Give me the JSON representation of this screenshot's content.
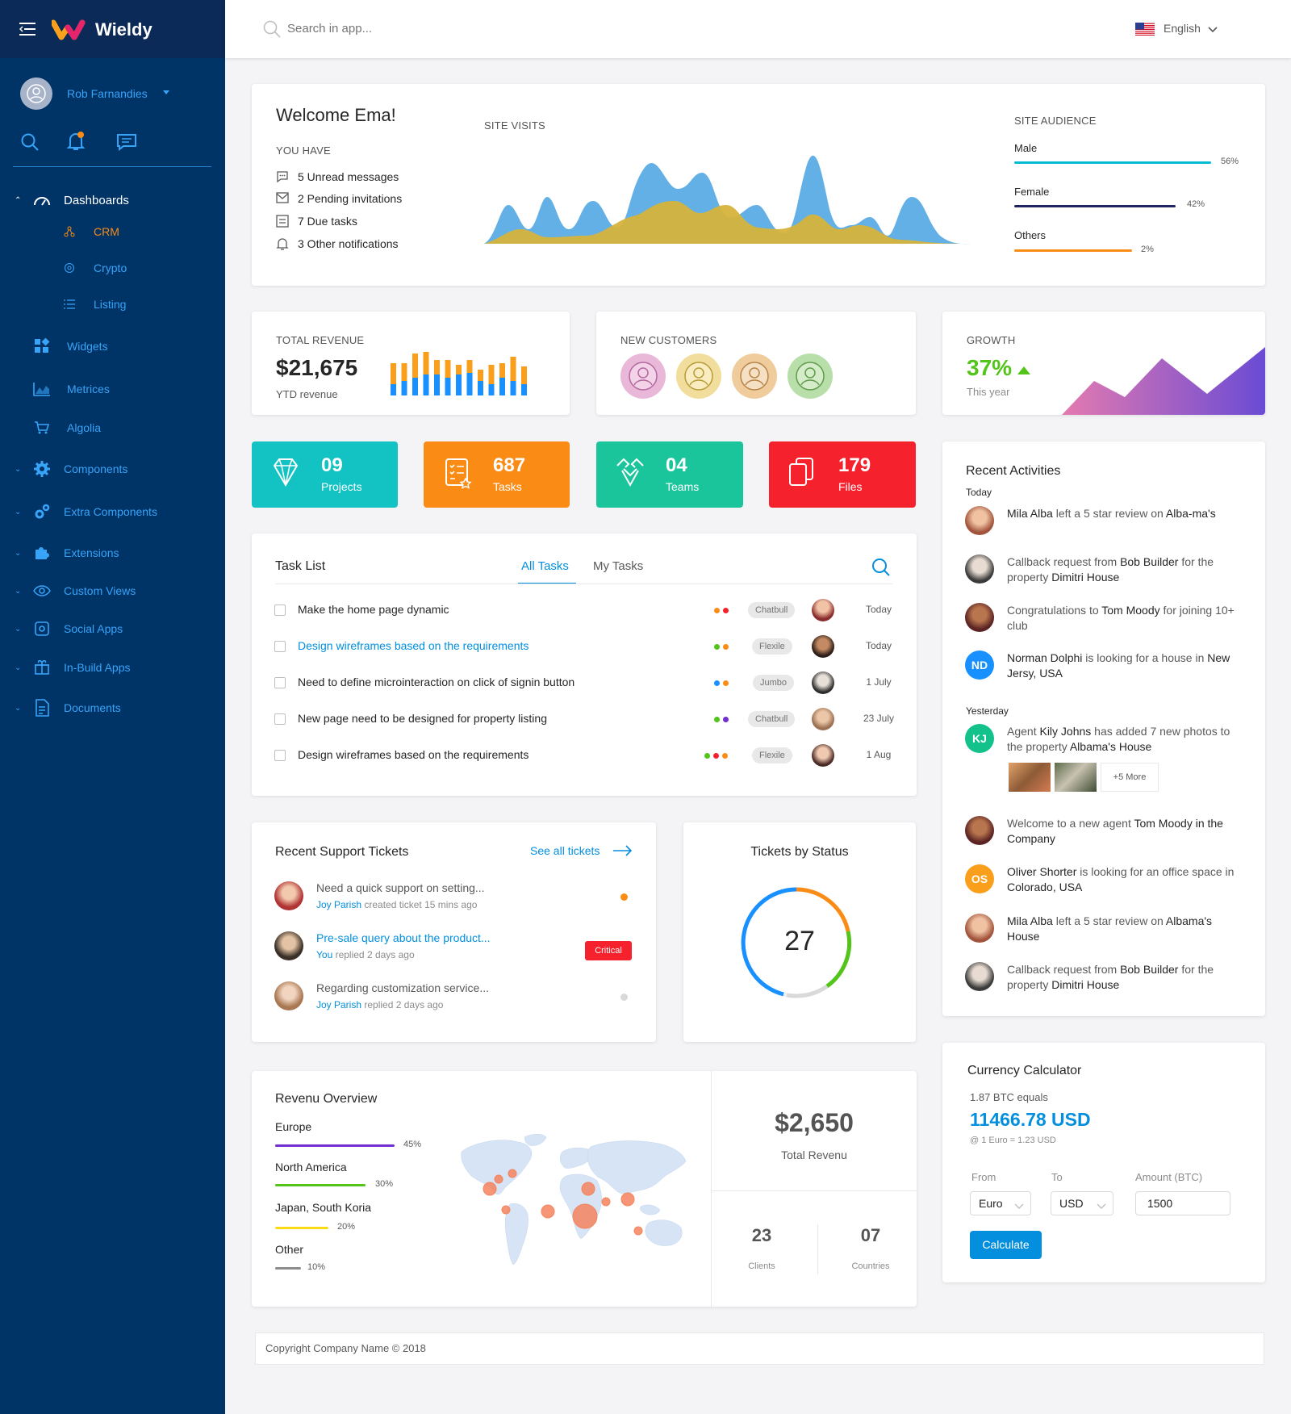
{
  "brand": {
    "name": "Wieldy"
  },
  "user": {
    "name": "Rob Farnandies"
  },
  "search": {
    "placeholder": "Search in app..."
  },
  "language": {
    "label": "English"
  },
  "sidebar": {
    "dashboards": "Dashboards",
    "sub": [
      "CRM",
      "Crypto",
      "Listing"
    ],
    "items": [
      "Widgets",
      "Metrices",
      "Algolia",
      "Components",
      "Extra Components",
      "Extensions",
      "Custom Views",
      "Social Apps",
      "In-Build Apps",
      "Documents"
    ]
  },
  "welcome": {
    "title": "Welcome Ema!",
    "you_have": "YOU HAVE",
    "items": [
      "5 Unread messages",
      "2 Pending invitations",
      "7 Due tasks",
      "3 Other notifications"
    ],
    "site_visits": "SITE VISITS",
    "site_audience": "SITE AUDIENCE",
    "audience": [
      {
        "label": "Male",
        "pct": "56%",
        "value": 56,
        "color": "#03bcd4"
      },
      {
        "label": "Female",
        "pct": "42%",
        "value": 42,
        "color": "#1f2360"
      },
      {
        "label": "Others",
        "pct": "2%",
        "value": 2,
        "color": "#fa8c16"
      }
    ]
  },
  "revenue": {
    "caption": "TOTAL REVENUE",
    "value": "$21,675",
    "sub": "YTD revenue"
  },
  "customers": {
    "caption": "NEW CUSTOMERS"
  },
  "growth": {
    "caption": "GROWTH",
    "value": "37%",
    "sub": "This year"
  },
  "stats": [
    {
      "num": "09",
      "label": "Projects",
      "color": "#13c2c2",
      "icon": "diamond-icon"
    },
    {
      "num": "687",
      "label": "Tasks",
      "color": "#fa8c16",
      "icon": "tasks-icon"
    },
    {
      "num": "04",
      "label": "Teams",
      "color": "#1bc59c",
      "icon": "teams-icon"
    },
    {
      "num": "179",
      "label": "Files",
      "color": "#f5222d",
      "icon": "files-icon"
    }
  ],
  "tasks": {
    "title": "Task List",
    "tab_all": "All Tasks",
    "tab_my": "My Tasks",
    "rows": [
      {
        "text": "Make the home page dynamic",
        "tag": "Chatbull",
        "date": "Today"
      },
      {
        "text": "Design wireframes based on the requirements",
        "tag": "Flexile",
        "date": "Today"
      },
      {
        "text": "Need to define microinteraction on click of signin button",
        "tag": "Jumbo",
        "date": "1 July"
      },
      {
        "text": "New page need to be designed for property listing",
        "tag": "Chatbull",
        "date": "23 July"
      },
      {
        "text": "Design wireframes based on the requirements",
        "tag": "Flexile",
        "date": "1 Aug"
      }
    ]
  },
  "activities": {
    "title": "Recent Activities",
    "today": "Today",
    "yesterday": "Yesterday",
    "a1": {
      "b1": "Mila Alba",
      "t1": " left a 5 star review on ",
      "b2": "Alba-ma's"
    },
    "a2": {
      "t1": "Callback request from ",
      "b1": "Bob Builder",
      "t2": " for the property ",
      "b2": "Dimitri House"
    },
    "a3": {
      "t1": "Congratulations to ",
      "b1": "Tom Moody",
      "t2": " for joining 10+ club"
    },
    "a4": {
      "initials": "ND",
      "b1": "Norman Dolphi",
      "t1": " is looking for a house in ",
      "b2": "New Jersy, USA"
    },
    "a5": {
      "initials": "KJ",
      "t1": "Agent ",
      "b1": "Kily Johns",
      "t2": " has added 7 new photos to the property ",
      "b2": "Albama's House",
      "more": "+5 More"
    },
    "a6": {
      "t1": "Welcome to a new agent ",
      "b1": "Tom Moody in the Company"
    },
    "a7": {
      "initials": "OS",
      "b1": "Oliver Shorter",
      "t1": " is looking for an office space in ",
      "b2": "Colorado, USA"
    },
    "a8": {
      "b1": "Mila Alba",
      "t1": " left a 5 star review on ",
      "b2": "Albama's House"
    },
    "a9": {
      "t1": "Callback request from ",
      "b1": "Bob Builder",
      "t2": " for the property ",
      "b2": "Dimitri House"
    }
  },
  "tickets": {
    "title": "Recent Support Tickets",
    "see_all": "See all tickets",
    "rows": [
      {
        "title": "Need a quick support on setting...",
        "who": "Joy Parish",
        "rest": " created ticket 15 mins ago"
      },
      {
        "title": "Pre-sale query about the product...",
        "who": "You",
        "rest": " replied 2 days ago",
        "badge": "Critical"
      },
      {
        "title": "Regarding customization service...",
        "who": "Joy Parish",
        "rest": " replied 2 days ago"
      }
    ]
  },
  "status": {
    "title": "Tickets by Status",
    "count": "27"
  },
  "overview": {
    "title": "Revenu Overview",
    "regions": [
      {
        "name": "Europe",
        "pct": "45%",
        "value": 45,
        "color": "#722ed1"
      },
      {
        "name": "North America",
        "pct": "30%",
        "value": 30,
        "color": "#52c41a"
      },
      {
        "name": "Japan, South Koria",
        "pct": "20%",
        "value": 20,
        "color": "#fadb14"
      },
      {
        "name": "Other",
        "pct": "10%",
        "value": 10,
        "color": "#8c8c8c"
      }
    ],
    "total": "$2,650",
    "total_label": "Total Revenu",
    "clients": "23",
    "clients_label": "Clients",
    "countries": "07",
    "countries_label": "Countries"
  },
  "currency": {
    "title": "Currency Calculator",
    "equals": "1.87 BTC equals",
    "result": "11466.78 USD",
    "rate": "@ 1 Euro = 1.23 USD",
    "from_label": "From",
    "to_label": "To",
    "amount_label": "Amount (BTC)",
    "from": "Euro",
    "to": "USD",
    "amount": "1500",
    "button": "Calculate"
  },
  "footer": {
    "text": "Copyright Company Name © 2018"
  }
}
